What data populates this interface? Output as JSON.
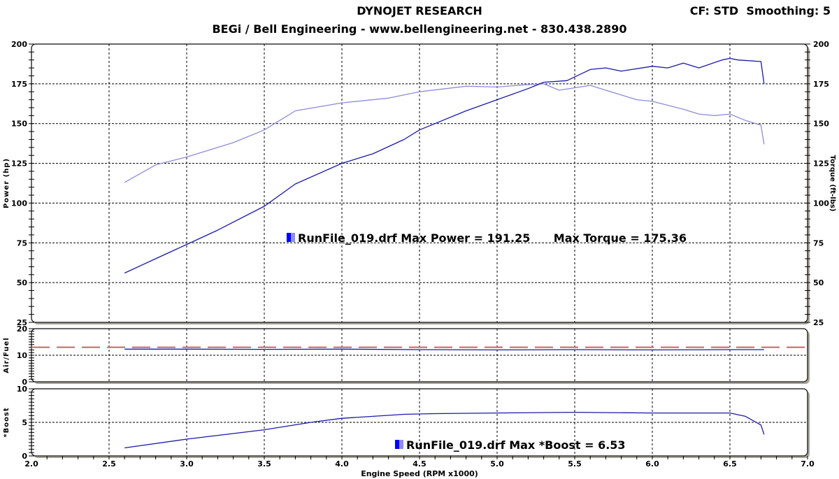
{
  "header": {
    "title": "DYNOJET RESEARCH",
    "subtitle": "BEGi / Bell Engineering - www.bellengineering.net - 830.438.2890",
    "settings": "CF: STD  Smoothing: 5"
  },
  "colors": {
    "power": "#1a1aa8",
    "torque": "#8c8cd8",
    "afr": "#1a1aa8",
    "afr_reference": "#c86464",
    "boost": "#1a1aa8"
  },
  "chart_data": [
    {
      "type": "line",
      "xlabel": "Engine Speed (RPM x1000)",
      "ylabel": "Power (hp)",
      "y2label": "Torque (ft-lbs)",
      "xlim": [
        2.0,
        7.0
      ],
      "ylim": [
        25,
        200
      ],
      "y2lim": [
        25,
        200
      ],
      "grid": true,
      "xticks": [
        "2.0",
        "2.5",
        "3.0",
        "3.5",
        "4.0",
        "4.5",
        "5.0",
        "5.5",
        "6.0",
        "6.5",
        "7.0"
      ],
      "yticks": [
        "200",
        "175",
        "150",
        "125",
        "100",
        "75",
        "50",
        "25"
      ],
      "annotation": "RunFile_019.drf Max Power = 191.25      Max Torque = 175.36",
      "series": [
        {
          "name": "Power",
          "x": [
            2.6,
            2.8,
            3.0,
            3.2,
            3.5,
            3.7,
            4.0,
            4.2,
            4.4,
            4.5,
            4.8,
            5.0,
            5.2,
            5.3,
            5.45,
            5.6,
            5.7,
            5.8,
            6.0,
            6.1,
            6.2,
            6.3,
            6.45,
            6.5,
            6.55,
            6.7,
            6.72
          ],
          "y": [
            56,
            65,
            74,
            83,
            98,
            112,
            125,
            131,
            140,
            146,
            158,
            165,
            172,
            176,
            177,
            184,
            185,
            183,
            186,
            185,
            188,
            185,
            190,
            191,
            190,
            189,
            175
          ]
        },
        {
          "name": "Torque",
          "x": [
            2.6,
            2.8,
            3.0,
            3.3,
            3.5,
            3.6,
            3.7,
            4.0,
            4.3,
            4.5,
            4.8,
            5.0,
            5.2,
            5.3,
            5.4,
            5.6,
            5.7,
            5.9,
            6.0,
            6.2,
            6.3,
            6.4,
            6.5,
            6.6,
            6.7,
            6.72
          ],
          "y": [
            113,
            124,
            129,
            138,
            146,
            152,
            158,
            163,
            166,
            170,
            173.5,
            173,
            174.5,
            175,
            171,
            174,
            171,
            165,
            164,
            159,
            156,
            155,
            156,
            152,
            149,
            137
          ]
        }
      ]
    },
    {
      "type": "line",
      "ylabel": "Air/Fuel",
      "xlim": [
        2.0,
        7.0
      ],
      "ylim": [
        0,
        20
      ],
      "yticks": [
        "20",
        "10",
        "0"
      ],
      "reference": 13,
      "series": [
        {
          "x": [
            2.6,
            3.0,
            3.5,
            4.0,
            4.5,
            5.0,
            5.5,
            6.0,
            6.5,
            6.72
          ],
          "y": [
            12.3,
            12.3,
            12.2,
            12.3,
            12.1,
            12.0,
            12.1,
            12.0,
            12.1,
            12.1
          ]
        }
      ]
    },
    {
      "type": "line",
      "ylabel": "*Boost",
      "xlim": [
        2.0,
        7.0
      ],
      "ylim": [
        0,
        10
      ],
      "yticks": [
        "10",
        "5",
        "0"
      ],
      "annotation": "RunFile_019.drf Max *Boost = 6.53",
      "series": [
        {
          "x": [
            2.6,
            3.0,
            3.5,
            3.8,
            4.0,
            4.4,
            4.6,
            5.0,
            5.5,
            6.0,
            6.5,
            6.6,
            6.7,
            6.72
          ],
          "y": [
            1.2,
            2.5,
            3.9,
            5.0,
            5.6,
            6.2,
            6.3,
            6.4,
            6.5,
            6.4,
            6.4,
            5.9,
            4.6,
            3.2
          ]
        }
      ]
    }
  ]
}
